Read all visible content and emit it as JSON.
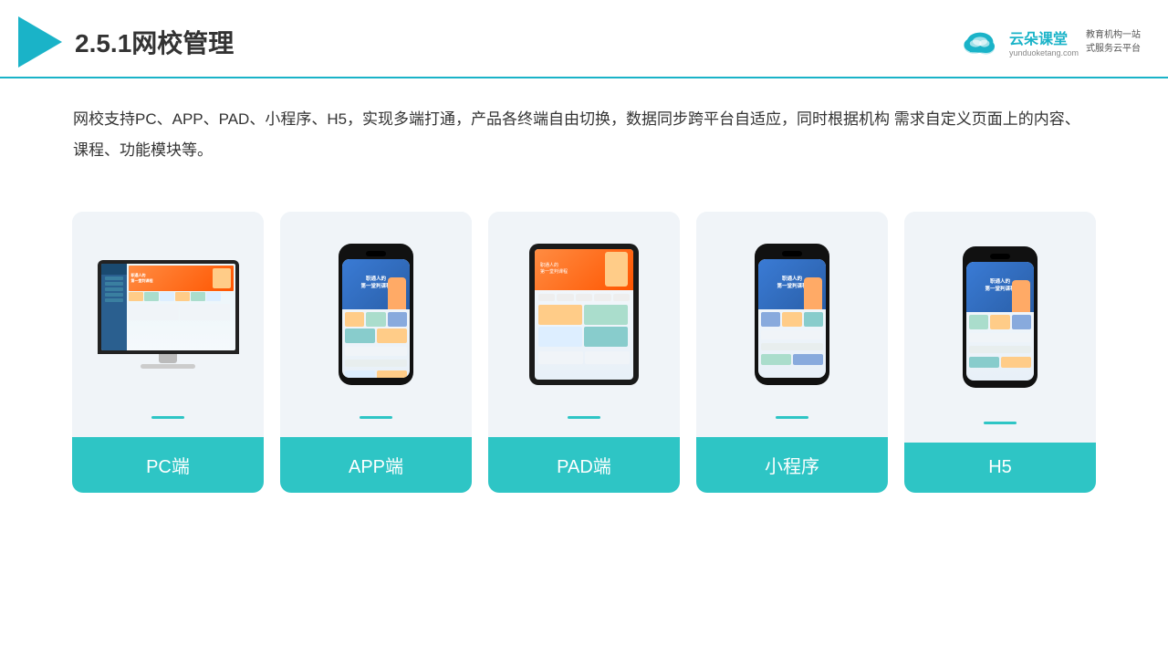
{
  "header": {
    "title": "2.5.1网校管理",
    "brand": {
      "name": "云朵课堂",
      "url": "yunduoketang.com",
      "slogan": "教育机构一站\n式服务云平台"
    }
  },
  "description": "网校支持PC、APP、PAD、小程序、H5，实现多端打通，产品各终端自由切换，数据同步跨平台自适应，同时根据机构\n需求自定义页面上的内容、课程、功能模块等。",
  "cards": [
    {
      "id": "pc",
      "label": "PC端"
    },
    {
      "id": "app",
      "label": "APP端"
    },
    {
      "id": "pad",
      "label": "PAD端"
    },
    {
      "id": "miniprogram",
      "label": "小程序"
    },
    {
      "id": "h5",
      "label": "H5"
    }
  ]
}
